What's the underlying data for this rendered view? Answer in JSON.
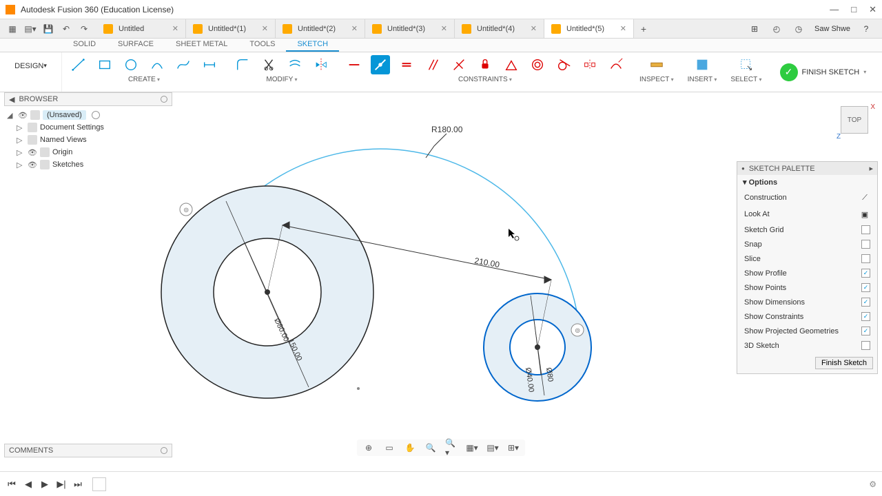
{
  "app": {
    "title": "Autodesk Fusion 360 (Education License)"
  },
  "tabs": [
    {
      "label": "Untitled",
      "active": false
    },
    {
      "label": "Untitled*(1)",
      "active": false
    },
    {
      "label": "Untitled*(2)",
      "active": false
    },
    {
      "label": "Untitled*(3)",
      "active": false
    },
    {
      "label": "Untitled*(4)",
      "active": false
    },
    {
      "label": "Untitled*(5)",
      "active": true
    }
  ],
  "user": "Saw Shwe",
  "workspace": "DESIGN",
  "env_tabs": [
    "SOLID",
    "SURFACE",
    "SHEET METAL",
    "TOOLS",
    "SKETCH"
  ],
  "env_active": 4,
  "ribbon_groups": {
    "create": "CREATE",
    "modify": "MODIFY",
    "constraints": "CONSTRAINTS",
    "inspect": "INSPECT",
    "insert": "INSERT",
    "select": "SELECT",
    "finish": "FINISH SKETCH"
  },
  "browser": {
    "title": "BROWSER",
    "root": "(Unsaved)",
    "items": [
      "Document Settings",
      "Named Views",
      "Origin",
      "Sketches"
    ]
  },
  "palette": {
    "title": "SKETCH PALETTE",
    "section": "Options",
    "rows": [
      {
        "label": "Construction",
        "type": "icon"
      },
      {
        "label": "Look At",
        "type": "icon"
      },
      {
        "label": "Sketch Grid",
        "type": "check",
        "checked": false
      },
      {
        "label": "Snap",
        "type": "check",
        "checked": false
      },
      {
        "label": "Slice",
        "type": "check",
        "checked": false
      },
      {
        "label": "Show Profile",
        "type": "check",
        "checked": true
      },
      {
        "label": "Show Points",
        "type": "check",
        "checked": true
      },
      {
        "label": "Show Dimensions",
        "type": "check",
        "checked": true
      },
      {
        "label": "Show Constraints",
        "type": "check",
        "checked": true
      },
      {
        "label": "Show Projected Geometries",
        "type": "check",
        "checked": true
      },
      {
        "label": "3D Sketch",
        "type": "check",
        "checked": false
      }
    ],
    "finish": "Finish Sketch"
  },
  "viewcube": "TOP",
  "comments": "COMMENTS",
  "dimensions": {
    "radius": "R180.00",
    "distance": "210.00",
    "d1": "Ø80.00",
    "d2": "150.00",
    "d3": "Ø40.00",
    "d4": "Ø80"
  },
  "chart_data": {
    "type": "sketch",
    "features": [
      {
        "kind": "arc",
        "radius": 180.0,
        "label": "R180.00"
      },
      {
        "kind": "circle",
        "diameter": 150.0,
        "role": "large-outer",
        "label": "150.00"
      },
      {
        "kind": "circle",
        "diameter": 80.0,
        "role": "large-inner",
        "label": "Ø80.00"
      },
      {
        "kind": "circle",
        "diameter": 80.0,
        "role": "small-outer",
        "label": "Ø80"
      },
      {
        "kind": "circle",
        "diameter": 40.0,
        "role": "small-inner",
        "label": "Ø40.00"
      },
      {
        "kind": "linear-dimension",
        "value": 210.0,
        "label": "210.00"
      }
    ]
  }
}
